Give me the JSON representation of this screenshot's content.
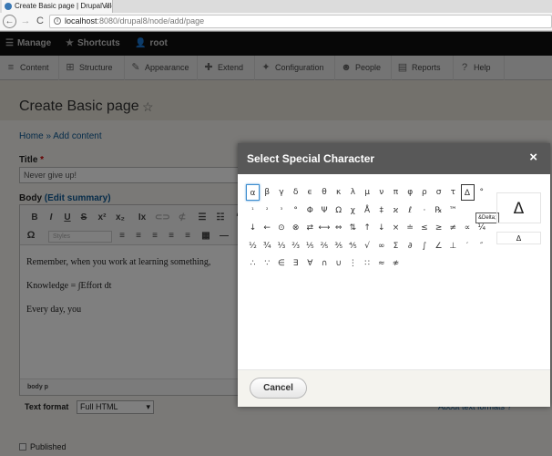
{
  "browser": {
    "tab_title": "Create Basic page | DrupalVille",
    "tab_close": "×",
    "back": "←",
    "forward": "→",
    "reload": "C",
    "url_host": "localhost",
    "url_path": ":8080/drupal8/node/add/page"
  },
  "toolbar": {
    "manage": "Manage",
    "shortcuts": "Shortcuts",
    "user": "root"
  },
  "tray": [
    {
      "label": "Content",
      "icon": "≡"
    },
    {
      "label": "Structure",
      "icon": "⊞"
    },
    {
      "label": "Appearance",
      "icon": "✎"
    },
    {
      "label": "Extend",
      "icon": "✚"
    },
    {
      "label": "Configuration",
      "icon": "✦"
    },
    {
      "label": "People",
      "icon": "☻"
    },
    {
      "label": "Reports",
      "icon": "▤"
    },
    {
      "label": "Help",
      "icon": "?"
    }
  ],
  "page": {
    "title": "Create Basic page",
    "star": "☆",
    "breadcrumb": "Home » Add content",
    "title_label": "Title",
    "required_mark": "*",
    "title_value": "Never give up!",
    "body_label": "Body",
    "edit_summary": "(Edit summary)",
    "styles_placeholder": "Styles",
    "body_lines": [
      "Remember, when you work at learning something,",
      "Knowledge = ∫Effort dt",
      "Every day, you"
    ],
    "element_path": "body  p",
    "text_format_label": "Text format",
    "text_format_value": "Full HTML",
    "about_text_formats": "About text formats",
    "published_label": "Published"
  },
  "editor_toolbar": {
    "bold": "B",
    "italic": "I",
    "underline": "U",
    "strike": "S",
    "superscript": "x²",
    "subscript": "x₂",
    "remove_format": "Ix",
    "omega": "Ω"
  },
  "dialog": {
    "title": "Select Special Character",
    "close": "×",
    "cancel": "Cancel",
    "tooltip": "&Delta;",
    "preview_char": "Δ",
    "preview_code": "Δ",
    "rows": [
      [
        "α",
        "β",
        "γ",
        "δ",
        "ϵ",
        "θ",
        "κ",
        "λ",
        "μ",
        "ν",
        "π",
        "φ",
        "ρ",
        "σ",
        "τ",
        "Δ",
        "°"
      ],
      [
        "¹",
        "²",
        "³",
        "°",
        "Φ",
        "Ψ",
        "Ω",
        "χ",
        "Å",
        "‡",
        "ϰ",
        "ℓ",
        "·",
        "℞",
        "™",
        "",
        ""
      ],
      [
        "↓",
        "←",
        "⊙",
        "⊗",
        "⇄",
        "⟷",
        "⇔",
        "⇅",
        "↑",
        "↓",
        "×",
        "≐",
        "≤",
        "≥",
        "≠",
        "∝",
        "¼"
      ],
      [
        "½",
        "¾",
        "⅓",
        "⅔",
        "⅕",
        "⅖",
        "⅗",
        "⅘",
        "√",
        "∞",
        "Σ",
        "∂",
        "∫",
        "∠",
        "⊥",
        "′",
        "″"
      ],
      [
        "∴",
        "∵",
        "∈",
        "∃",
        "∀",
        "∩",
        "∪",
        "⋮",
        "∷",
        "≈",
        "≉"
      ]
    ]
  }
}
